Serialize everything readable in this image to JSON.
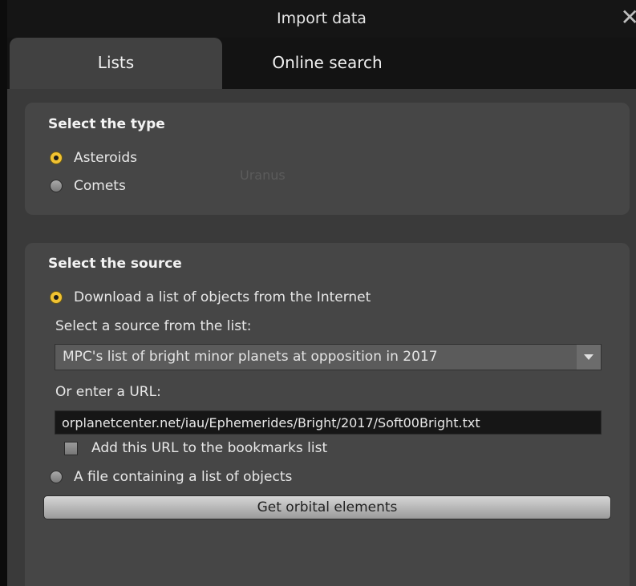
{
  "dialog": {
    "title": "Import data",
    "close_glyph": "✕"
  },
  "tabs": [
    {
      "label": "Lists",
      "active": true
    },
    {
      "label": "Online search",
      "active": false
    }
  ],
  "type_group": {
    "title": "Select the type",
    "options": [
      {
        "label": "Asteroids",
        "selected": true
      },
      {
        "label": "Comets",
        "selected": false
      }
    ],
    "background_text": "Uranus"
  },
  "source_group": {
    "title": "Select the source",
    "download_option": {
      "label": "Download a list of objects from the Internet",
      "selected": true
    },
    "select_label": "Select a source from the list:",
    "source_list": {
      "selected": "MPC's list of bright minor planets at opposition in 2017"
    },
    "url_label": "Or enter a URL:",
    "url_value": "orplanetcenter.net/iau/Ephemerides/Bright/2017/Soft00Bright.txt",
    "bookmark_checkbox": {
      "label": "Add this URL to the bookmarks list",
      "checked": false
    },
    "file_option": {
      "label": "A file containing a list of objects",
      "selected": false
    },
    "get_button": "Get orbital elements"
  },
  "colors": {
    "accent_radio": "#f1c232",
    "panel": "#464646"
  }
}
